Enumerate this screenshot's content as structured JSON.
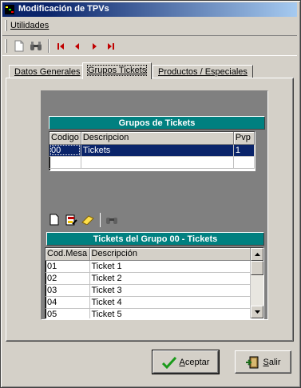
{
  "window": {
    "title": "Modificación de TPVs"
  },
  "menu": {
    "items": [
      {
        "label": "Utilidades"
      }
    ]
  },
  "tabs": [
    {
      "label": "Datos Generales",
      "active": false
    },
    {
      "label": "Grupos Tickets",
      "active": true
    },
    {
      "label": "Productos / Especiales",
      "active": false
    }
  ],
  "groups": {
    "title": "Grupos de Tickets",
    "columns": [
      "Codigo",
      "Descripcion",
      "Pvp"
    ],
    "rows": [
      {
        "codigo": "00",
        "descripcion": "Tickets",
        "pvp": "1",
        "selected": true
      }
    ]
  },
  "tickets": {
    "title": "Tickets del Grupo 00 - Tickets",
    "columns": [
      "Cod.Mesa",
      "Descripción"
    ],
    "rows": [
      {
        "cod": "01",
        "desc": "Ticket 1"
      },
      {
        "cod": "02",
        "desc": "Ticket 2"
      },
      {
        "cod": "03",
        "desc": "Ticket 3"
      },
      {
        "cod": "04",
        "desc": "Ticket 4"
      },
      {
        "cod": "05",
        "desc": "Ticket 5"
      }
    ]
  },
  "buttons": {
    "accept": "Aceptar",
    "exit": "Salir"
  },
  "colors": {
    "title_bar": "#0a246a",
    "header_bar": "#008080",
    "selection": "#0a246a",
    "nav_arrow": "#c00000",
    "accept_check": "#1a9a1a"
  }
}
